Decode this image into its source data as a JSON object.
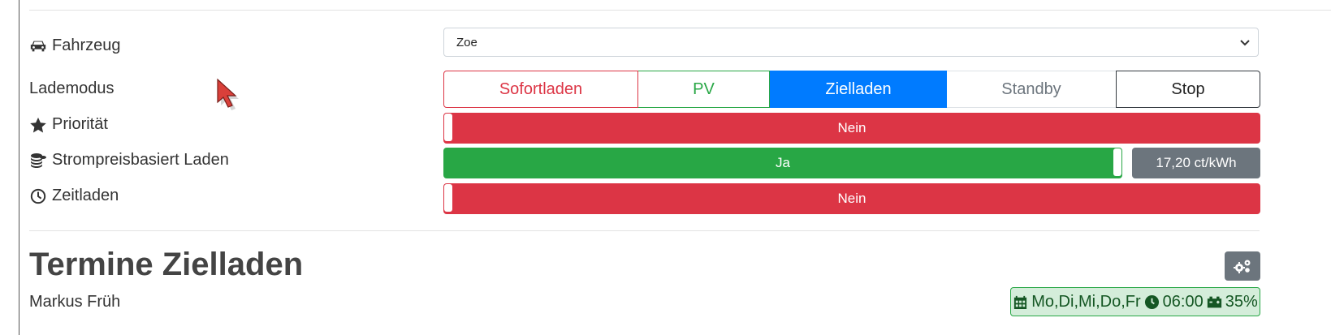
{
  "vehicle": {
    "label": "Fahrzeug",
    "icon": "car-icon",
    "selected": "Zoe"
  },
  "charge_mode": {
    "label": "Lademodus",
    "active": "Zielladen",
    "buttons": [
      {
        "label": "Sofortladen",
        "color": "#dc3545"
      },
      {
        "label": "PV",
        "color": "#28a745"
      },
      {
        "label": "Zielladen",
        "color": "#007bff"
      },
      {
        "label": "Standby",
        "color": "#6c757d"
      },
      {
        "label": "Stop",
        "color": "#343a40"
      }
    ]
  },
  "priority": {
    "label": "Priorität",
    "icon": "star-icon",
    "value": "Nein",
    "on": false
  },
  "price_based": {
    "label": "Strompreisbasiert Laden",
    "icon": "coins-icon",
    "value": "Ja",
    "on": true,
    "price": "17,20 ct/kWh"
  },
  "time_charging": {
    "label": "Zeitladen",
    "icon": "clock-icon",
    "value": "Nein",
    "on": false
  },
  "schedule": {
    "title": "Termine Zielladen",
    "owner": "Markus Früh",
    "days": "Mo,Di,Mi,Do,Fr",
    "time": "06:00",
    "soc": "35%"
  },
  "colors": {
    "red": "#dc3545",
    "green": "#28a745",
    "blue": "#007bff",
    "gray": "#6c757d"
  }
}
